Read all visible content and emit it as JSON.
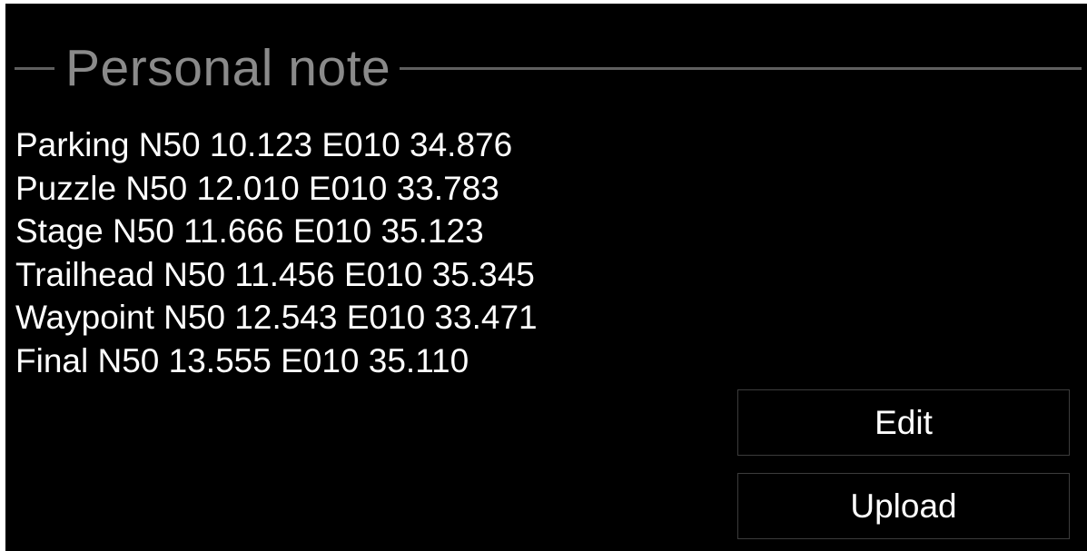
{
  "section": {
    "title": "Personal note"
  },
  "note": {
    "lines": [
      "Parking N50 10.123 E010 34.876",
      "Puzzle N50 12.010 E010 33.783",
      "Stage N50 11.666 E010 35.123",
      "Trailhead N50 11.456 E010 35.345",
      "Waypoint N50 12.543 E010 33.471",
      "Final N50 13.555 E010 35.110"
    ]
  },
  "actions": {
    "edit_label": "Edit",
    "upload_label": "Upload"
  }
}
